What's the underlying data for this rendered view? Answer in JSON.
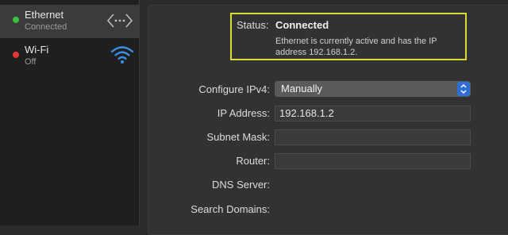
{
  "services": [
    {
      "name": "Ethernet",
      "status": "Connected",
      "dot_color": "#38c33c",
      "icon": "ethernet-arrows-icon"
    },
    {
      "name": "Wi-Fi",
      "status": "Off",
      "dot_color": "#e8333a",
      "icon": "wifi-icon"
    }
  ],
  "status": {
    "label": "Status:",
    "value": "Connected",
    "description": "Ethernet is currently active and has the IP address 192.168.1.2.",
    "highlight_color": "#d6dc36"
  },
  "form": {
    "configure_label": "Configure IPv4:",
    "configure_value": "Manually",
    "ip_label": "IP Address:",
    "ip_value": "192.168.1.2",
    "subnet_label": "Subnet Mask:",
    "subnet_value": "",
    "router_label": "Router:",
    "router_value": "",
    "dns_label": "DNS Server:",
    "search_label": "Search Domains:"
  },
  "accent_color": "#2f6fd6"
}
